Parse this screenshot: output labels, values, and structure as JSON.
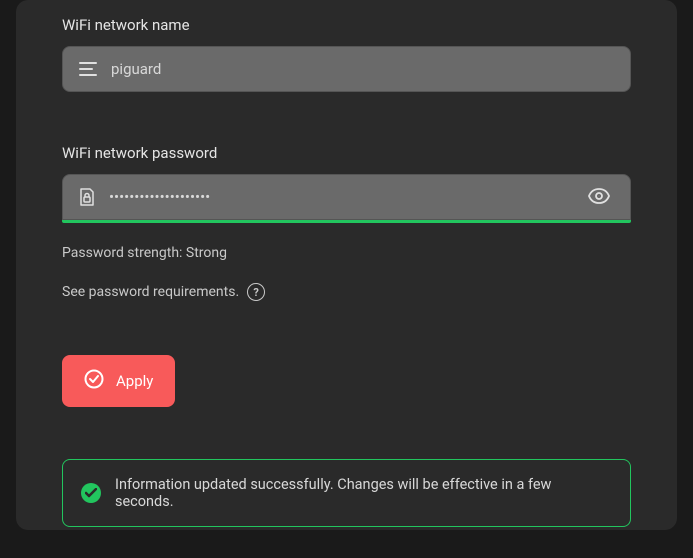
{
  "wifi_name": {
    "label": "WiFi network name",
    "value": "piguard"
  },
  "wifi_password": {
    "label": "WiFi network password",
    "value": "••••••••••••••••••••",
    "strength_label": "Password strength: Strong",
    "requirements_text": "See password requirements."
  },
  "apply_button": {
    "label": "Apply"
  },
  "success": {
    "message": "Information updated successfully. Changes will be effective in a few seconds."
  },
  "colors": {
    "accent_green": "#22c55e",
    "accent_red": "#f85a5a"
  }
}
